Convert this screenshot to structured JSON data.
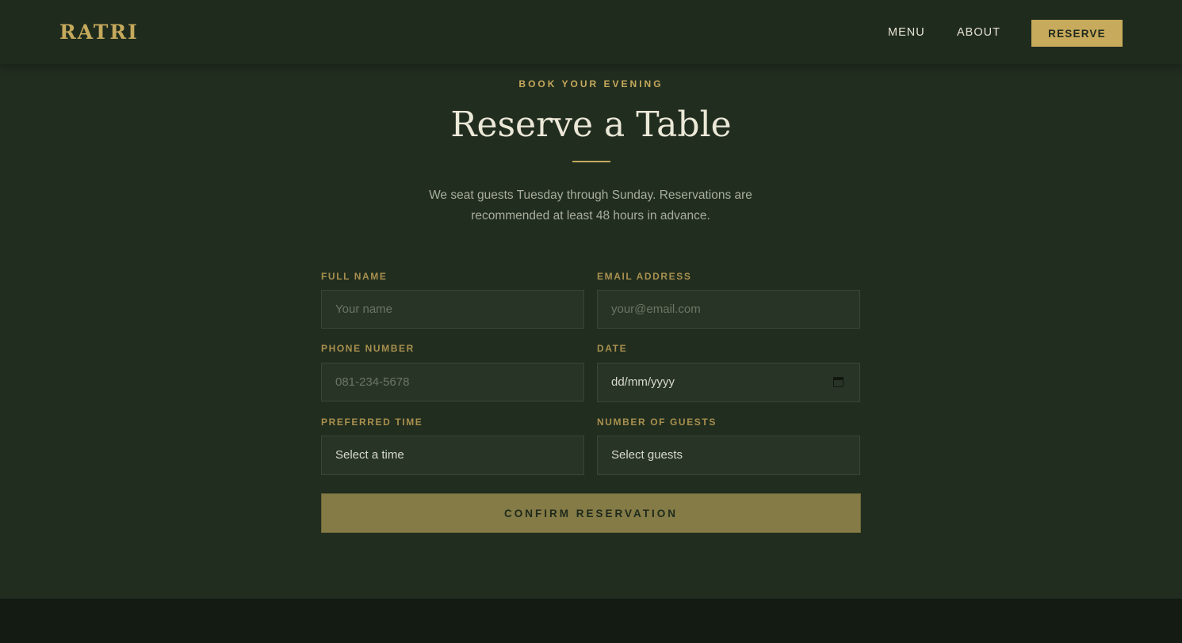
{
  "brand": {
    "name": "RATRI",
    "color": "#c5a95c"
  },
  "nav": {
    "items": [
      {
        "label": "MENU"
      },
      {
        "label": "ABOUT"
      }
    ],
    "reserve_label": "RESERVE"
  },
  "hero": {
    "eyebrow": "BOOK YOUR EVENING",
    "title": "Reserve a Table",
    "intro": "We seat guests Tuesday through Sunday. Reservations are recommended at least 48 hours in advance."
  },
  "form": {
    "full_name": {
      "label": "FULL NAME",
      "placeholder": "Your name",
      "value": ""
    },
    "email": {
      "label": "EMAIL ADDRESS",
      "placeholder": "your@email.com",
      "value": ""
    },
    "phone": {
      "label": "PHONE NUMBER",
      "placeholder": "081-234-5678",
      "value": ""
    },
    "date": {
      "label": "DATE",
      "value": "dd/mm/yyyy"
    },
    "time": {
      "label": "PREFERRED TIME",
      "selected": "Select a time"
    },
    "guests": {
      "label": "NUMBER OF GUESTS",
      "selected": "Select guests"
    },
    "submit_label": "CONFIRM RESERVATION"
  },
  "colors": {
    "background": "#212d1f",
    "accent": "#c5a95c",
    "submit": "#857b46",
    "footer": "#131b12"
  }
}
